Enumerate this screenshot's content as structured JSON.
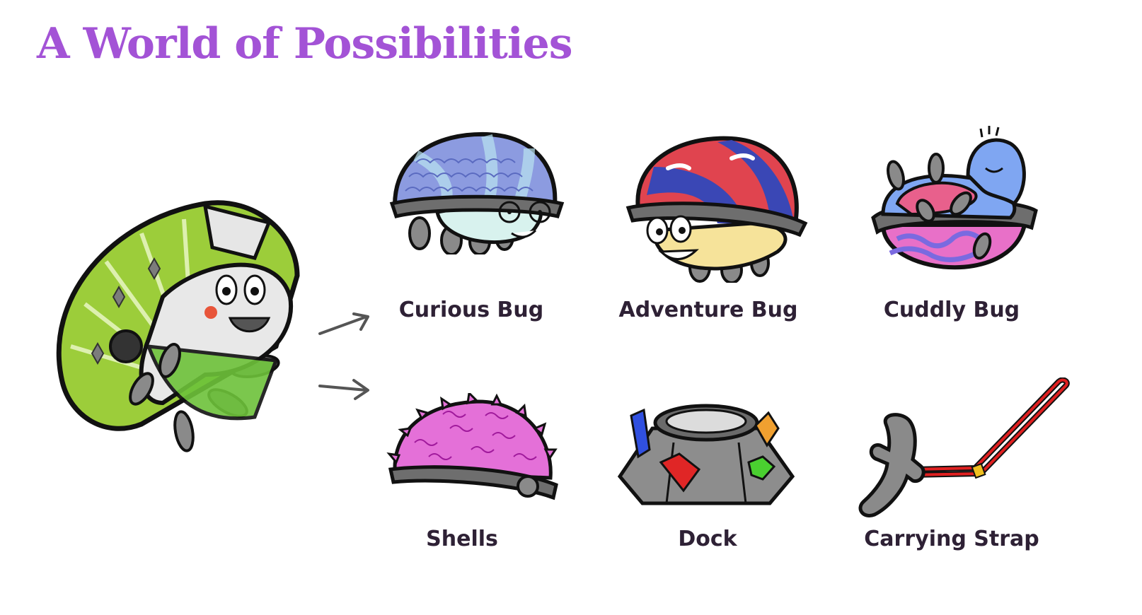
{
  "title": "A World of Possibilities",
  "items": [
    {
      "label": "Curious Bug"
    },
    {
      "label": "Adventure Bug"
    },
    {
      "label": "Cuddly Bug"
    },
    {
      "label": "Shells"
    },
    {
      "label": "Dock"
    },
    {
      "label": "Carrying Strap"
    }
  ],
  "colors": {
    "title": "#a353d6",
    "label": "#2e2135",
    "outline": "#111111",
    "shell_gray": "#6e6e6e",
    "main_bug_green": "#9ccd3a",
    "curious_shell": "#8c9be0",
    "adventure_red": "#e0444f",
    "adventure_blue": "#3a47b5",
    "cuddly_blue": "#7fa6f2",
    "cuddly_pink": "#e8608c",
    "shells_pink": "#e470d8",
    "strap_red": "#e02020"
  }
}
